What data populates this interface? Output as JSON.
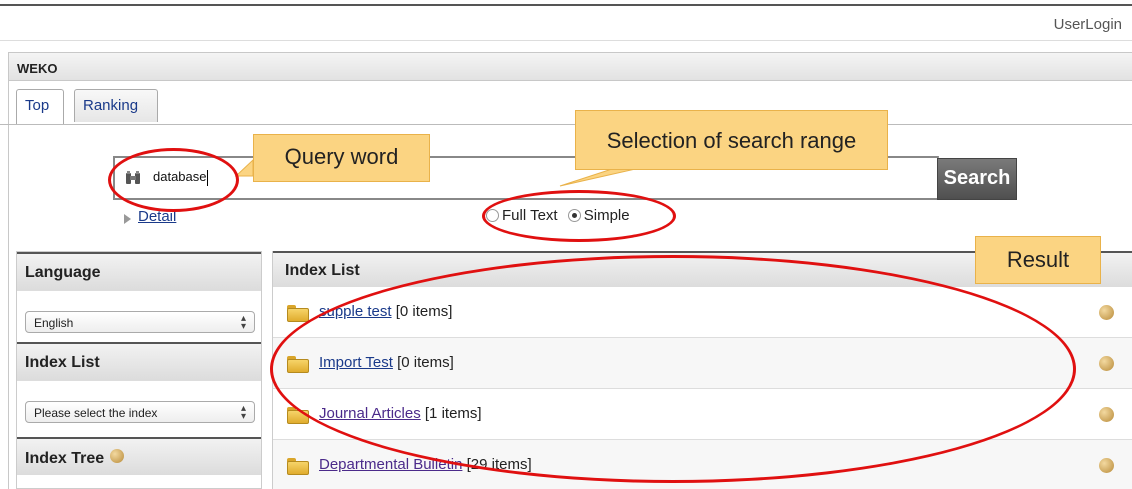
{
  "header": {
    "user_login": "UserLogin"
  },
  "panel": {
    "title": "WEKO"
  },
  "tabs": [
    {
      "label": "Top"
    },
    {
      "label": "Ranking"
    }
  ],
  "search": {
    "value": "database",
    "button_label": "Search",
    "detail_label": "Detail",
    "range_options": [
      {
        "label": "Full Text",
        "selected": false
      },
      {
        "label": "Simple",
        "selected": true
      }
    ]
  },
  "sidebar": {
    "language": {
      "heading": "Language",
      "selected": "English"
    },
    "index_list": {
      "heading": "Index List",
      "selected": "Please select the index"
    },
    "index_tree": {
      "heading": "Index Tree"
    }
  },
  "index_list": {
    "heading": "Index List",
    "rows": [
      {
        "name": "supple test",
        "count": "[0 items]"
      },
      {
        "name": "Import Test",
        "count": "[0 items]"
      },
      {
        "name": "Journal Articles",
        "count": "[1 items]"
      },
      {
        "name": "Departmental Bulletin",
        "count": "[29 items]"
      }
    ]
  },
  "callouts": {
    "query": "Query word",
    "range": "Selection of search range",
    "result": "Result"
  },
  "colors": {
    "callout_fill": "#fbd482",
    "highlight_ring": "#e01010",
    "link": "#1a3a8a",
    "search_button": "#5a5a5a"
  }
}
